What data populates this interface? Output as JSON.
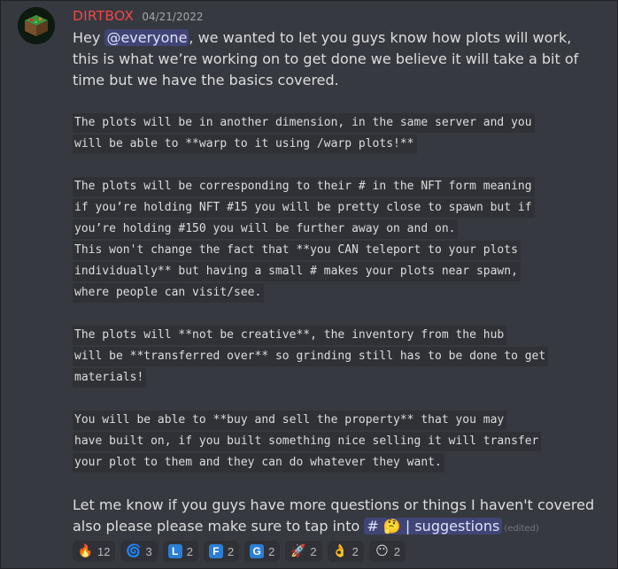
{
  "author": {
    "name": "DIRTBOX",
    "timestamp": "04/21/2022"
  },
  "message": {
    "intro_before": "Hey ",
    "mention": "@everyone",
    "intro_after": ", we wanted to let you guys know how plots will work, this is what we’re working on to get done we believe it will take a bit of time but we have the basics covered.",
    "code_lines": [
      "The plots will be in another dimension, in the same server and you",
      "will be able to **warp to it using /warp plots!**",
      "The plots will be corresponding to their # in the NFT form meaning",
      "if you’re holding NFT #15 you will be pretty close to spawn but if",
      "you’re holding #150 you will be further away on and on.",
      "This won't change the fact that **you CAN teleport to your plots",
      "individually** but having a small # makes your plots near spawn,",
      "where people can visit/see.",
      "The plots will **not be creative**, the inventory from the hub",
      "will be **transferred over** so grinding still has to be done to get",
      "materials!",
      "You will be able to **buy and sell the property** that you may",
      "have built on, if you built something nice selling it will transfer",
      "your plot to them and they can do whatever they want."
    ],
    "outro": "Let me know if you guys have more questions or things I haven't covered also please please make sure to tap into ",
    "channel": {
      "hash": "#",
      "emoji": "🤔",
      "separator": "|",
      "name": "suggestions"
    },
    "edited": "(edited)"
  },
  "reactions": [
    {
      "icon": "fire-emoji",
      "glyph": "🔥",
      "count": "12"
    },
    {
      "icon": "spiral-emoji",
      "glyph": "🌀",
      "count": "3"
    },
    {
      "icon": "letter-l-emoji",
      "glyph": "L",
      "color": "#2a7fd4",
      "count": "2"
    },
    {
      "icon": "letter-f-emoji",
      "glyph": "F",
      "color": "#2a7fd4",
      "count": "2"
    },
    {
      "icon": "letter-g-emoji",
      "glyph": "G",
      "color": "#2a7fd4",
      "count": "2"
    },
    {
      "icon": "rocket-emoji",
      "glyph": "🚀",
      "count": "2"
    },
    {
      "icon": "ok-hand-emoji",
      "glyph": "👌",
      "count": "2"
    },
    {
      "icon": "face-emoji",
      "glyph": "😶",
      "count": "2"
    }
  ]
}
